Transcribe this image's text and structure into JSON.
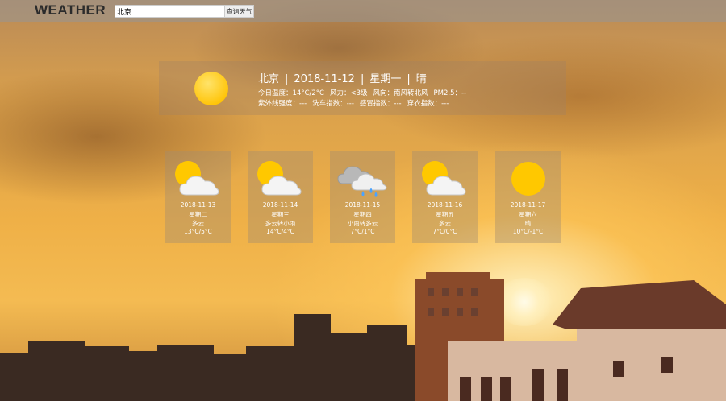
{
  "header": {
    "logo": "WEATHER",
    "search_value": "北京",
    "search_button": "查询天气"
  },
  "today": {
    "city": "北京",
    "date": "2018-11-12",
    "weekday": "星期一",
    "condition": "晴",
    "icon": "sun-icon",
    "temperature": "今日温度：14°C/2°C",
    "wind_force": "风力：<3级",
    "wind_direction": "风向：南风转北风",
    "pm25": "PM2.5：--",
    "uv": "紫外线强度：---",
    "carwash": "洗车指数：---",
    "cold": "感冒指数：---",
    "dressing": "穿衣指数：---"
  },
  "forecast": [
    {
      "date": "2018-11-13",
      "weekday": "星期二",
      "condition": "多云",
      "temp": "13°C/5°C",
      "icon": "partly-cloudy-icon"
    },
    {
      "date": "2018-11-14",
      "weekday": "星期三",
      "condition": "多云转小雨",
      "temp": "14°C/4°C",
      "icon": "partly-cloudy-icon"
    },
    {
      "date": "2018-11-15",
      "weekday": "星期四",
      "condition": "小雨转多云",
      "temp": "7°C/1°C",
      "icon": "rain-cloud-icon"
    },
    {
      "date": "2018-11-16",
      "weekday": "星期五",
      "condition": "多云",
      "temp": "7°C/0°C",
      "icon": "partly-cloudy-icon"
    },
    {
      "date": "2018-11-17",
      "weekday": "星期六",
      "condition": "晴",
      "temp": "10°C/-1°C",
      "icon": "sun-icon"
    }
  ],
  "colors": {
    "sun": "#ffc800",
    "cloud": "#ffffff",
    "rain": "#4aa3ff"
  }
}
